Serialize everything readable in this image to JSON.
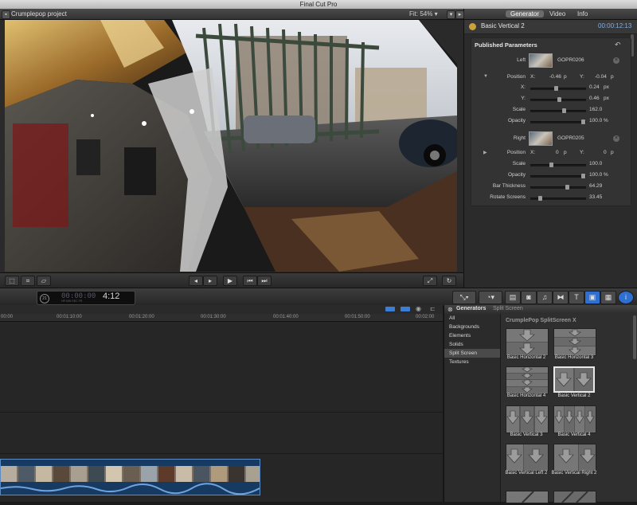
{
  "window": {
    "title": "Final Cut Pro"
  },
  "viewer": {
    "project_name": "Crumplepop project",
    "fit_label": "Fit:",
    "zoom": "54%"
  },
  "inspector": {
    "tabs": [
      "Generator",
      "Video",
      "Info"
    ],
    "active_tab": "Generator",
    "clip_name": "Basic Vertical 2",
    "duration": "00:00:12:13",
    "section_title": "Published Parameters",
    "left": {
      "label": "Left",
      "media": "GOPR0206"
    },
    "position_label": "Position",
    "position_x_label": "X:",
    "position_x": "-0.46",
    "position_x_unit": "p",
    "position_y_label": "Y:",
    "position_y": "-0.04",
    "position_y_unit": "p",
    "x_label": "X:",
    "x_value": "0.24",
    "x_unit": "px",
    "y_label": "Y:",
    "y_value": "0.46",
    "y_unit": "px",
    "scale_label": "Scale",
    "scale_value": "162.0",
    "opacity_label": "Opacity",
    "opacity_value": "100.0",
    "opacity_unit": "%",
    "right": {
      "label": "Right",
      "media": "GOPR0205"
    },
    "r_position_label": "Position",
    "r_position_x_label": "X:",
    "r_position_x": "0",
    "r_position_x_unit": "p",
    "r_position_y_label": "Y:",
    "r_position_y": "0",
    "r_position_y_unit": "p",
    "r_scale_label": "Scale",
    "r_scale_value": "100.0",
    "r_opacity_label": "Opacity",
    "r_opacity_value": "100.0",
    "r_opacity_unit": "%",
    "bar_label": "Bar Thickness",
    "bar_value": "64.29",
    "rotate_label": "Rotate Screens",
    "rotate_value": "33.45"
  },
  "toolbar": {
    "timecode": "4:12",
    "timecode_prefix": "00:00:00",
    "timecode_units": "HR  MIN  SEC  FR"
  },
  "timeline": {
    "ticks": [
      "00:00",
      "00:01:10:00",
      "00:01:20:00",
      "00:01:30:00",
      "00:01:40:00",
      "00:01:50:00",
      "00:02:00"
    ]
  },
  "generators": {
    "title": "Generators",
    "breadcrumb": "Split Screen",
    "categories": [
      "All",
      "Backgrounds",
      "Elements",
      "Solids",
      "Split Screen",
      "Textures"
    ],
    "selected_category": "Split Screen",
    "group_title": "CrumplePop SplitScreen X",
    "items": [
      "Basic Horizontal 2",
      "Basic Horizontal 3",
      "Basic Horizontal 4",
      "Basic Vertical 2",
      "Basic Vertical 3",
      "Basic Vertical 4",
      "Basic Vertical Left 2",
      "Basic Vertical Right 2"
    ],
    "selected_item": "Basic Vertical 2"
  }
}
